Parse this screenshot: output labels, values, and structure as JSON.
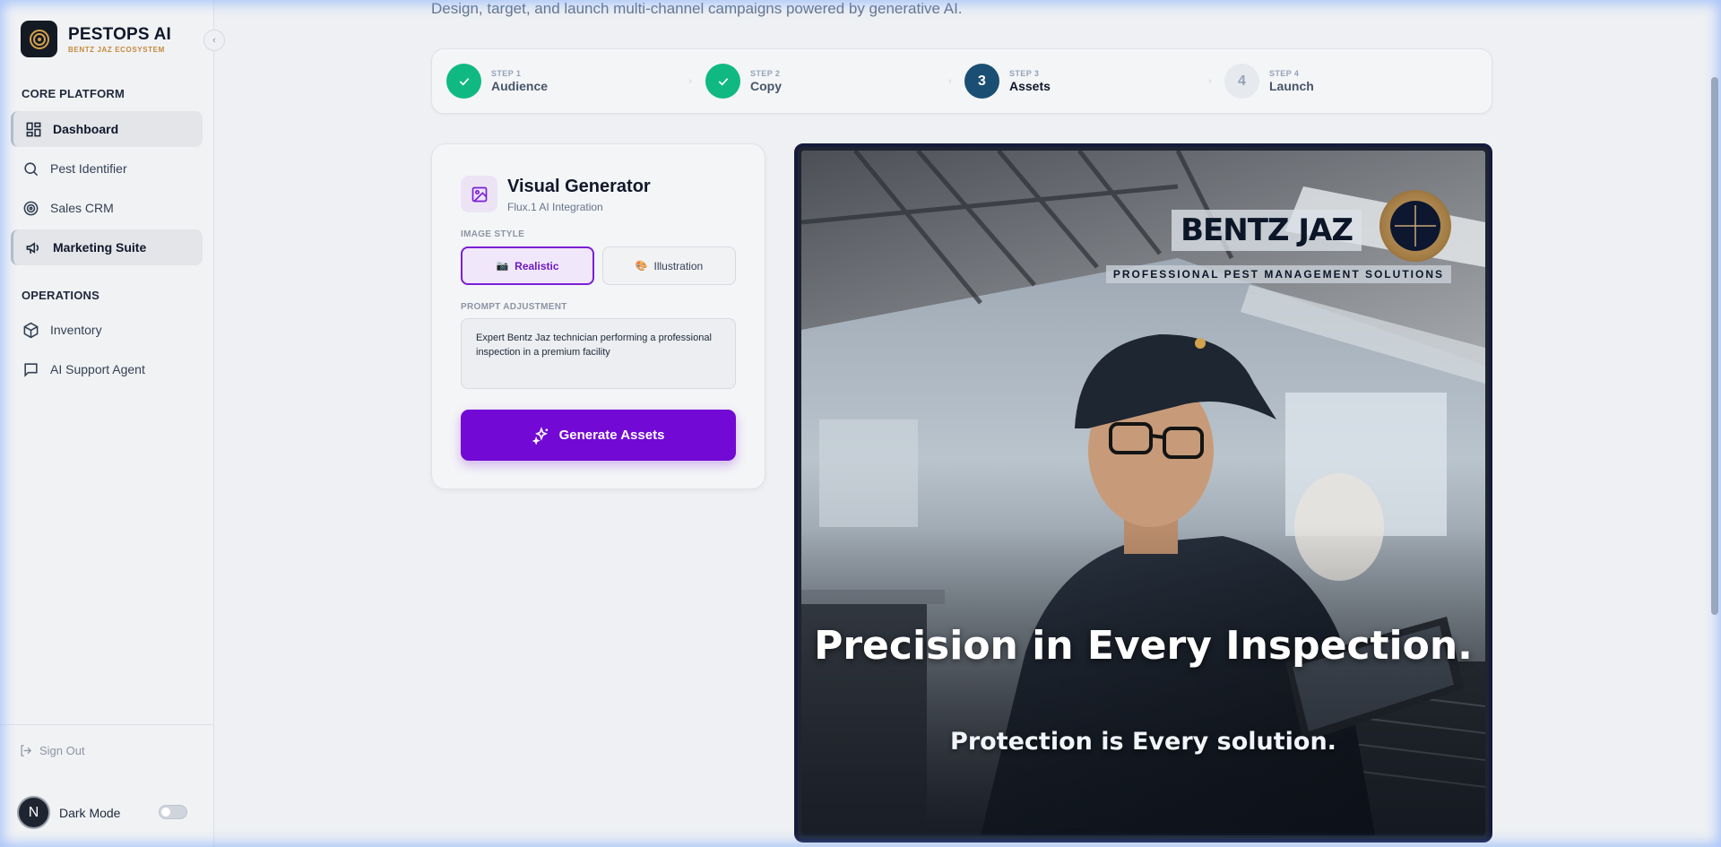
{
  "brand": {
    "title": "PESTOPS AI",
    "subtitle": "BENTZ JAZ ECOSYSTEM"
  },
  "sidebar": {
    "sections": [
      {
        "label": "CORE PLATFORM"
      },
      {
        "label": "OPERATIONS"
      }
    ],
    "items": [
      {
        "label": "Dashboard",
        "icon": "grid-icon",
        "active": true
      },
      {
        "label": "Pest Identifier",
        "icon": "search-icon",
        "active": false
      },
      {
        "label": "Sales CRM",
        "icon": "target-icon",
        "active": false
      },
      {
        "label": "Marketing Suite",
        "icon": "megaphone-icon",
        "active": true
      },
      {
        "label": "Inventory",
        "icon": "box-icon",
        "active": false
      },
      {
        "label": "AI Support Agent",
        "icon": "chat-icon",
        "active": false
      }
    ],
    "sign_out": "Sign Out",
    "user_initial": "N",
    "dark_mode_label": "Dark Mode",
    "dark_mode_on": false
  },
  "header": {
    "subtitle": "Design, target, and launch multi-channel campaigns powered by generative AI."
  },
  "stepper": {
    "steps": [
      {
        "num": "STEP 1",
        "name": "Audience",
        "state": "done",
        "badge": ""
      },
      {
        "num": "STEP 2",
        "name": "Copy",
        "state": "done",
        "badge": ""
      },
      {
        "num": "STEP 3",
        "name": "Assets",
        "state": "current",
        "badge": "3"
      },
      {
        "num": "STEP 4",
        "name": "Launch",
        "state": "todo",
        "badge": "4"
      }
    ]
  },
  "generator": {
    "title": "Visual Generator",
    "subtitle": "Flux.1 AI Integration",
    "image_style_label": "IMAGE STYLE",
    "style_options": [
      {
        "emoji": "📷",
        "label": "Realistic",
        "selected": true
      },
      {
        "emoji": "🎨",
        "label": "Illustration",
        "selected": false
      }
    ],
    "prompt_label": "PROMPT ADJUSTMENT",
    "prompt_value": "Expert Bentz Jaz technician performing a professional inspection in a premium facility",
    "generate_label": "Generate Assets",
    "accent": "#7209d4"
  },
  "preview": {
    "wordmark": "BENTZ JAZ",
    "tagline": "PROFESSIONAL PEST MANAGEMENT SOLUTIONS",
    "headline": "Precision in Every Inspection.",
    "subline": "Protection is Every solution."
  },
  "colors": {
    "success": "#10b981",
    "current_step": "#1a4f73",
    "frame": "#161b3b"
  }
}
